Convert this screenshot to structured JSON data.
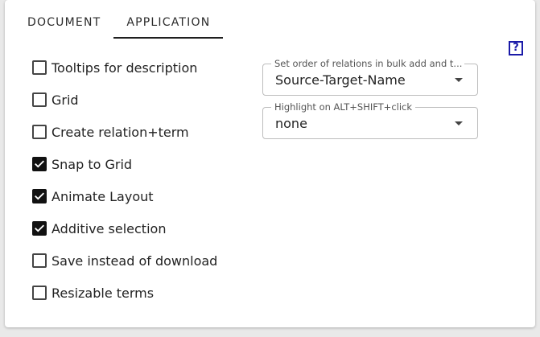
{
  "tabs": [
    {
      "label": "DOCUMENT",
      "active": false
    },
    {
      "label": "APPLICATION",
      "active": true
    }
  ],
  "help": {
    "label": "?"
  },
  "options": [
    {
      "label": "Tooltips for description",
      "checked": false
    },
    {
      "label": "Grid",
      "checked": false
    },
    {
      "label": "Create relation+term",
      "checked": false
    },
    {
      "label": "Snap to Grid",
      "checked": true
    },
    {
      "label": "Animate Layout",
      "checked": true
    },
    {
      "label": "Additive selection",
      "checked": true
    },
    {
      "label": "Save instead of download",
      "checked": false
    },
    {
      "label": "Resizable terms",
      "checked": false
    }
  ],
  "selects": [
    {
      "legend": "Set order of relations in bulk add and t...",
      "value": "Source-Target-Name"
    },
    {
      "legend": "Highlight on ALT+SHIFT+click",
      "value": "none"
    }
  ],
  "colors": {
    "help_icon": "#1a1aa8",
    "checkbox_checked": "#111111"
  }
}
